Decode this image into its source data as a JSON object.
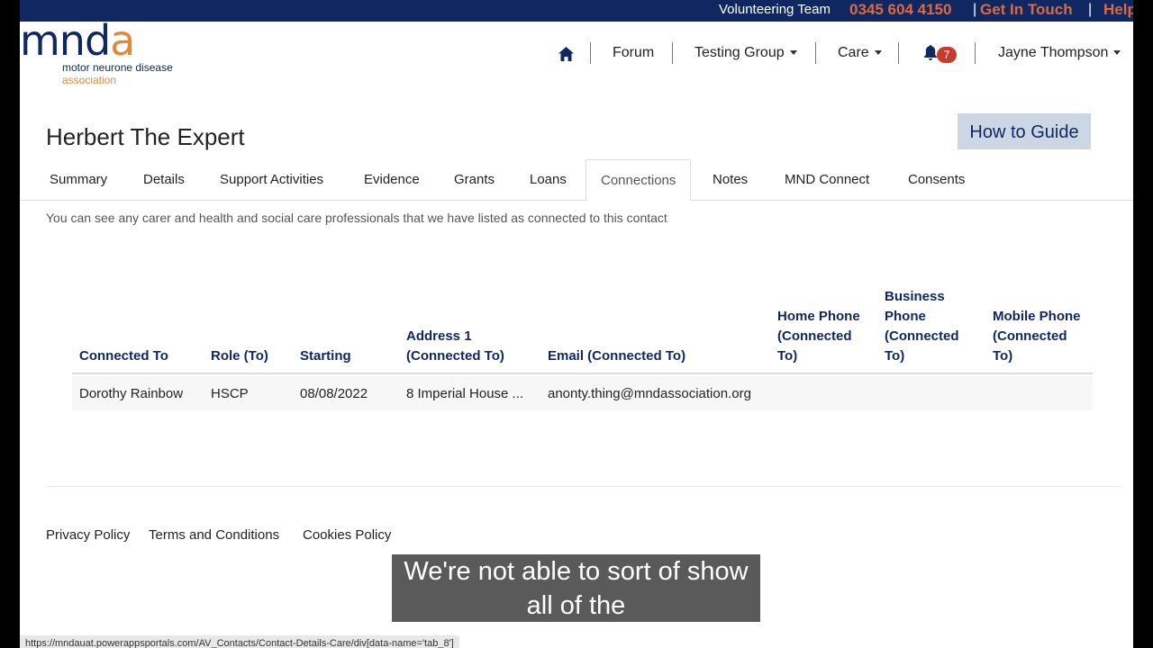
{
  "topbar": {
    "volunteering": "Volunteering Team",
    "phone": "0345 604 4150",
    "sep1": "|",
    "get_in_touch": "Get In Touch",
    "sep2": "|",
    "help": "Help"
  },
  "logo": {
    "mnd": "mnd",
    "a": "a",
    "line1": "motor neurone disease",
    "line2": "association"
  },
  "nav": {
    "forum": "Forum",
    "testing_group": "Testing Group",
    "care": "Care",
    "notifications": "7",
    "user": "Jayne Thompson"
  },
  "page": {
    "title": "Herbert The Expert",
    "how_to": "How to Guide",
    "description": "You can see any carer and health and social care professionals that we have listed as connected to this contact"
  },
  "tabs": [
    "Summary",
    "Details",
    "Support Activities",
    "Evidence",
    "Grants",
    "Loans",
    "Connections",
    "Notes",
    "MND Connect",
    "Consents"
  ],
  "table": {
    "headers": {
      "connected_to": "Connected To",
      "role": "Role (To)",
      "starting": "Starting",
      "address1_a": "Address 1",
      "address1_b": "(Connected To)",
      "email": "Email (Connected To)",
      "home_a": "Home Phone",
      "home_b": "(Connected",
      "home_c": "To)",
      "bus_a": "Business",
      "bus_b": "Phone",
      "bus_c": "(Connected",
      "bus_d": "To)",
      "mob_a": "Mobile Phone",
      "mob_b": "(Connected",
      "mob_c": "To)"
    },
    "rows": [
      {
        "connected_to": "Dorothy Rainbow",
        "role": "HSCP",
        "starting": "08/08/2022",
        "address1": "8 Imperial House ...",
        "email": "anonty.thing@mndassociation.org",
        "home": "",
        "business": "",
        "mobile": ""
      }
    ]
  },
  "footer": {
    "privacy": "Privacy Policy",
    "terms": "Terms and Conditions",
    "cookies": "Cookies Policy"
  },
  "caption": {
    "line1": "We're not able to sort of show",
    "line2": "all of the"
  },
  "status_url": "https://mndauat.powerappsportals.com/AV_Contacts/Contact-Details-Care/div[data-name='tab_8']"
}
